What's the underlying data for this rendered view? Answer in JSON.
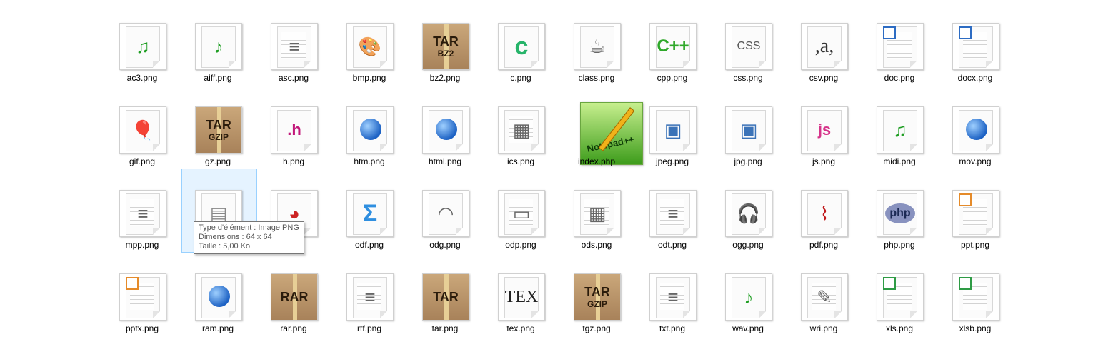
{
  "files": [
    {
      "name": "ac3.png",
      "icon": "audio-file-icon"
    },
    {
      "name": "aiff.png",
      "icon": "audio-wave-file-icon"
    },
    {
      "name": "asc.png",
      "icon": "text-file-icon"
    },
    {
      "name": "bmp.png",
      "icon": "paint-palette-icon"
    },
    {
      "name": "bz2.png",
      "icon": "archive-box-icon",
      "text": "TAR",
      "sub": "BZ2"
    },
    {
      "name": "c.png",
      "icon": "c-source-icon",
      "text": "c"
    },
    {
      "name": "class.png",
      "icon": "java-cup-icon"
    },
    {
      "name": "cpp.png",
      "icon": "cpp-source-icon",
      "text": "C++"
    },
    {
      "name": "css.png",
      "icon": "css-file-icon",
      "text": "CSS"
    },
    {
      "name": "csv.png",
      "icon": "csv-file-icon",
      "text": ",a,"
    },
    {
      "name": "doc.png",
      "icon": "word-document-icon"
    },
    {
      "name": "docx.png",
      "icon": "word-document-icon"
    },
    {
      "name": "gif.png",
      "icon": "image-balloon-icon"
    },
    {
      "name": "gz.png",
      "icon": "archive-box-icon",
      "text": "TAR",
      "sub": "GZIP"
    },
    {
      "name": "h.png",
      "icon": "header-file-icon",
      "text": ".h"
    },
    {
      "name": "htm.png",
      "icon": "web-globe-icon"
    },
    {
      "name": "html.png",
      "icon": "web-globe-icon"
    },
    {
      "name": "ics.png",
      "icon": "calendar-icon"
    },
    {
      "name": "index.php",
      "icon": "notepad-plus-plus-icon",
      "text": "Notepad++"
    },
    {
      "name": "jpeg.png",
      "icon": "photo-image-icon"
    },
    {
      "name": "jpg.png",
      "icon": "photo-image-icon"
    },
    {
      "name": "js.png",
      "icon": "javascript-file-icon",
      "text": "js"
    },
    {
      "name": "midi.png",
      "icon": "midi-piano-icon"
    },
    {
      "name": "mov.png",
      "icon": "quicktime-icon"
    },
    {
      "name": "mpp.png",
      "icon": "project-gantt-icon"
    },
    {
      "name": "",
      "icon": "database-icon"
    },
    {
      "name": "",
      "icon": "chart-pie-icon"
    },
    {
      "name": "odf.png",
      "icon": "formula-sigma-icon",
      "text": "Σ"
    },
    {
      "name": "odg.png",
      "icon": "drawing-icon"
    },
    {
      "name": "odp.png",
      "icon": "presentation-icon"
    },
    {
      "name": "ods.png",
      "icon": "spreadsheet-icon"
    },
    {
      "name": "odt.png",
      "icon": "text-document-icon"
    },
    {
      "name": "ogg.png",
      "icon": "headset-icon"
    },
    {
      "name": "pdf.png",
      "icon": "pdf-acrobat-icon"
    },
    {
      "name": "php.png",
      "icon": "php-file-icon",
      "text": "php"
    },
    {
      "name": "ppt.png",
      "icon": "powerpoint-icon"
    },
    {
      "name": "pptx.png",
      "icon": "powerpoint-icon"
    },
    {
      "name": "ram.png",
      "icon": "realmedia-icon"
    },
    {
      "name": "rar.png",
      "icon": "archive-box-icon",
      "text": "RAR"
    },
    {
      "name": "rtf.png",
      "icon": "rich-text-icon"
    },
    {
      "name": "tar.png",
      "icon": "archive-box-icon",
      "text": "TAR"
    },
    {
      "name": "tex.png",
      "icon": "tex-file-icon",
      "text": "TEX"
    },
    {
      "name": "tgz.png",
      "icon": "archive-box-icon",
      "text": "TAR",
      "sub": "GZIP"
    },
    {
      "name": "txt.png",
      "icon": "text-file-icon"
    },
    {
      "name": "wav.png",
      "icon": "audio-wave-file-icon"
    },
    {
      "name": "wri.png",
      "icon": "write-document-icon"
    },
    {
      "name": "xls.png",
      "icon": "excel-icon"
    },
    {
      "name": "xlsb.png",
      "icon": "excel-icon"
    }
  ],
  "tooltip": {
    "line1": "Type d'élément : Image PNG",
    "line2": "Dimensions : 64 x 64",
    "line3": "Taille : 5,00 Ko"
  },
  "colors": {
    "selection_border": "#99d1ff",
    "selection_fill": "#e5f3ff",
    "tooltip_border": "#767676"
  }
}
